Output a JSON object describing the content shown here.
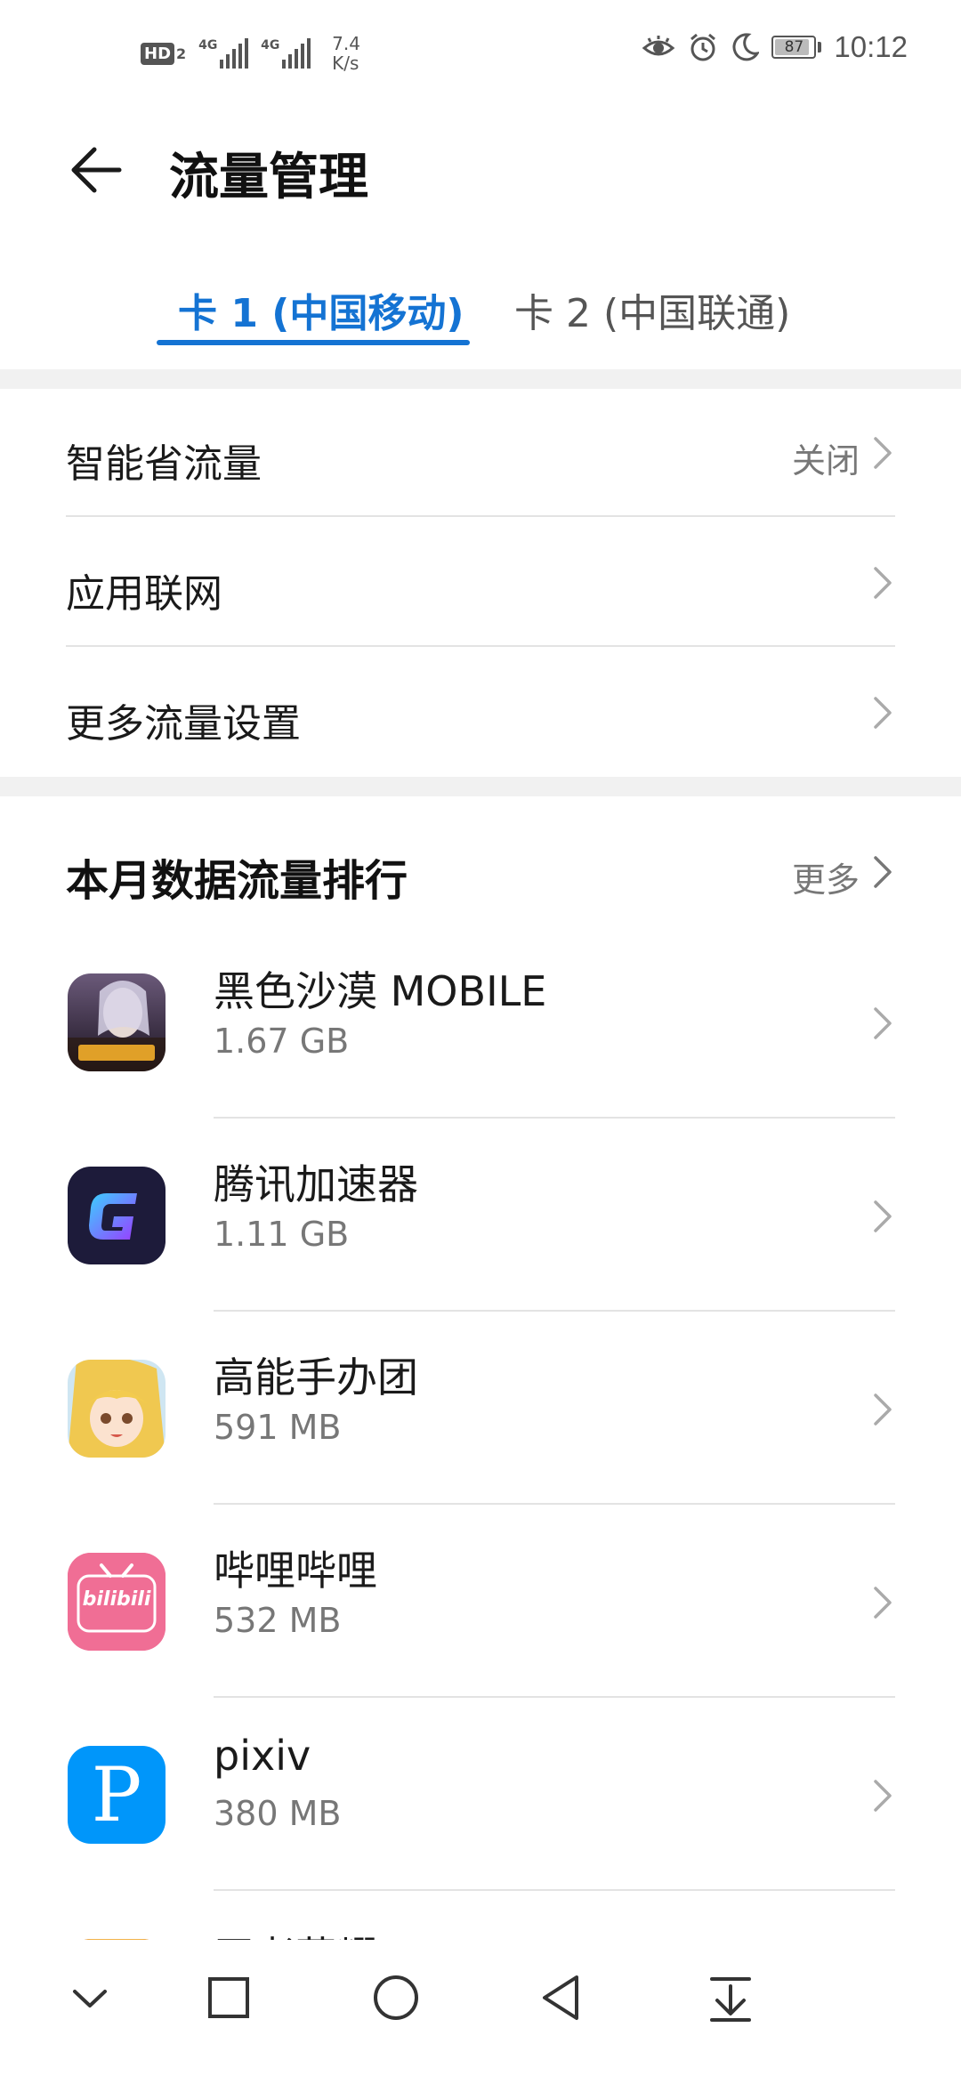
{
  "status_bar": {
    "hd_label": "HD",
    "hd_sim": "2",
    "sim1_network": "4G",
    "sim2_network": "4G",
    "speed_value": "7.4",
    "speed_unit": "K/s",
    "battery": "87",
    "time": "10:12"
  },
  "header": {
    "title": "流量管理"
  },
  "tabs": [
    {
      "label": "卡 1 (中国移动)",
      "active": true
    },
    {
      "label": "卡 2 (中国联通)",
      "active": false
    }
  ],
  "settings": [
    {
      "label": "智能省流量",
      "value": "关闭"
    },
    {
      "label": "应用联网",
      "value": ""
    },
    {
      "label": "更多流量设置",
      "value": ""
    }
  ],
  "ranking": {
    "title": "本月数据流量排行",
    "more_label": "更多",
    "apps": [
      {
        "name": "黑色沙漠 MOBILE",
        "size": "1.67 GB",
        "icon": "black-desert-icon"
      },
      {
        "name": "腾讯加速器",
        "size": "1.11 GB",
        "icon": "tencent-accelerator-icon"
      },
      {
        "name": "高能手办团",
        "size": "591 MB",
        "icon": "figure-team-icon"
      },
      {
        "name": "哔哩哔哩",
        "size": "532 MB",
        "icon": "bilibili-icon",
        "icon_text": "bilibili"
      },
      {
        "name": "pixiv",
        "size": "380 MB",
        "icon": "pixiv-icon",
        "icon_text": "P"
      },
      {
        "name": "王者荣耀",
        "size": "",
        "icon": "honor-of-kings-icon"
      }
    ]
  },
  "colors": {
    "accent": "#1473d3",
    "separator": "#f1f1f1"
  }
}
